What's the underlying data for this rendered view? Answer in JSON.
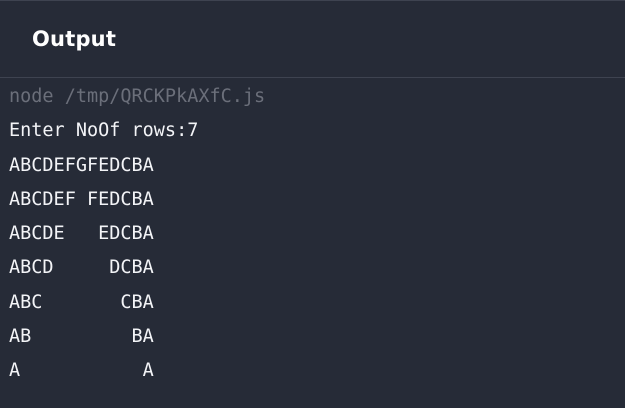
{
  "panel": {
    "title": "Output"
  },
  "console": {
    "command": "node /tmp/QRCKPkAXfC.js",
    "prompt": "Enter NoOf rows:7",
    "lines": [
      "ABCDEFGFEDCBA",
      "ABCDEF FEDCBA",
      "ABCDE   EDCBA",
      "ABCD     DCBA",
      "ABC       CBA",
      "AB         BA",
      "A           A"
    ]
  },
  "colors": {
    "background": "#262b37",
    "border": "#3e4350",
    "text": "#f3f4f7",
    "command_text": "#6b6f7a"
  }
}
